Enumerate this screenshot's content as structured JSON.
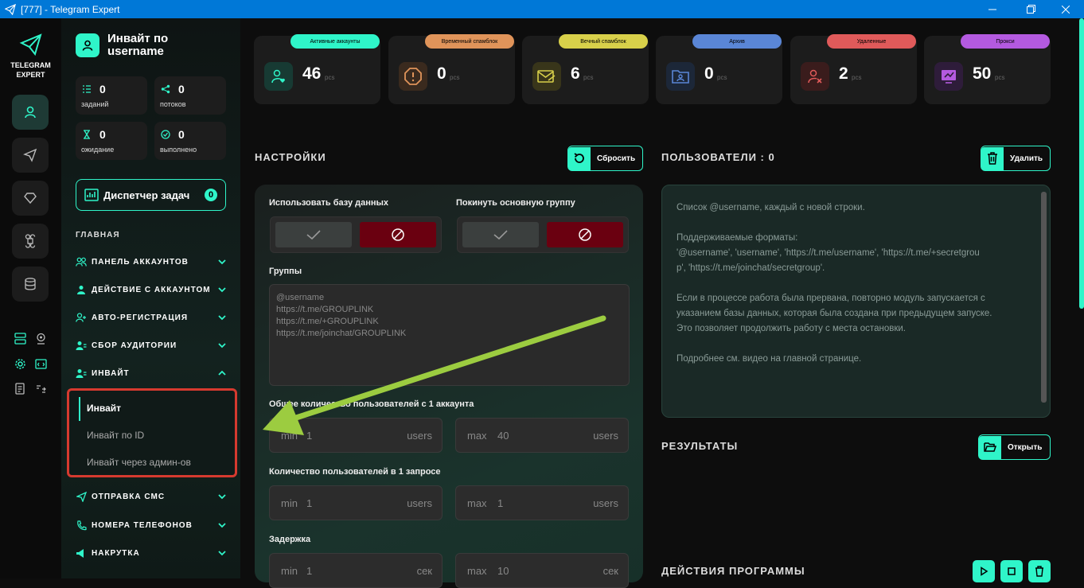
{
  "window": {
    "title": "[777] - Telegram Expert"
  },
  "brand": {
    "line1": "TELEGRAM",
    "line2": "EXPERT"
  },
  "sidebar": {
    "title": "Инвайт по username",
    "stats": [
      {
        "value": "0",
        "label": "заданий"
      },
      {
        "value": "0",
        "label": "потоков"
      },
      {
        "value": "0",
        "label": "ожидание"
      },
      {
        "value": "0",
        "label": "выполнено"
      }
    ],
    "dispatcher": {
      "label": "Диспетчер задач",
      "count": "0"
    },
    "section": "ГЛАВНАЯ",
    "nav": [
      {
        "label": "ПАНЕЛЬ АККАУНТОВ"
      },
      {
        "label": "ДЕЙСТВИЕ С АККАУНТОМ"
      },
      {
        "label": "АВТО-РЕГИСТРАЦИЯ"
      },
      {
        "label": "СБОР АУДИТОРИИ"
      },
      {
        "label": "ИНВАЙТ"
      },
      {
        "label": "ОТПРАВКА СМС"
      },
      {
        "label": "НОМЕРА ТЕЛЕФОНОВ"
      },
      {
        "label": "НАКРУТКА"
      }
    ],
    "invite_sub": [
      {
        "label": "Инвайт"
      },
      {
        "label": "Инвайт по ID"
      },
      {
        "label": "Инвайт через админ-ов"
      }
    ]
  },
  "cards": [
    {
      "badge": "Активные аккаунты",
      "value": "46",
      "unit": "pcs",
      "color": "#2ff5c9"
    },
    {
      "badge": "Временный спамблок",
      "value": "0",
      "unit": "pcs",
      "color": "#e0945a"
    },
    {
      "badge": "Вечный спамблок",
      "value": "6",
      "unit": "pcs",
      "color": "#d8d04a"
    },
    {
      "badge": "Архив",
      "value": "0",
      "unit": "pcs",
      "color": "#5a86d6"
    },
    {
      "badge": "Удаленные",
      "value": "2",
      "unit": "pcs",
      "color": "#e05a5a"
    },
    {
      "badge": "Прокси",
      "value": "50",
      "unit": "pcs",
      "color": "#b45ae0"
    }
  ],
  "settings": {
    "title": "НАСТРОЙКИ",
    "reset": "Сбросить",
    "use_db": "Использовать базу данных",
    "leave_group": "Покинуть основную группу",
    "groups_label": "Группы",
    "groups_placeholder": "@username\nhttps://t.me/GROUPLINK\nhttps://t.me/+GROUPLINK\nhttps://t.me/joinchat/GROUPLINK",
    "total_label": "Общее количество пользователей с 1 аккаунта",
    "per_req_label": "Количество пользователей в 1 запросе",
    "delay_label": "Задержка",
    "total": {
      "min_l": "min",
      "min_v": "1",
      "min_u": "users",
      "max_l": "max",
      "max_v": "40",
      "max_u": "users"
    },
    "per_req": {
      "min_l": "min",
      "min_v": "1",
      "min_u": "users",
      "max_l": "max",
      "max_v": "1",
      "max_u": "users"
    },
    "delay": {
      "min_l": "min",
      "min_v": "1",
      "min_u": "сек",
      "max_l": "max",
      "max_v": "10",
      "max_u": "сек"
    }
  },
  "users": {
    "title": "ПОЛЬЗОВАТЕЛИ : 0",
    "delete": "Удалить",
    "p1": "Список @username, каждый с новой строки.",
    "p2a": "Поддерживаемые форматы:",
    "p2b": "'@username', 'username', 'https://t.me/username', 'https://t.me/+secretgrou",
    "p2c": "p', 'https://t.me/joinchat/secretgroup'.",
    "p3a": "Если в процессе работа была прервана, повторно модуль запускается с",
    "p3b": "указанием базы данных, которая была создана при предыдущем запуске.",
    "p3c": "Это позволяет продолжить работу с места остановки.",
    "p4": "Подробнее см. видео на главной странице."
  },
  "results": {
    "title": "РЕЗУЛЬТАТЫ",
    "open": "Открыть"
  },
  "actions": {
    "title": "ДЕЙСТВИЯ ПРОГРАММЫ"
  },
  "accent": "#2ff5c9"
}
